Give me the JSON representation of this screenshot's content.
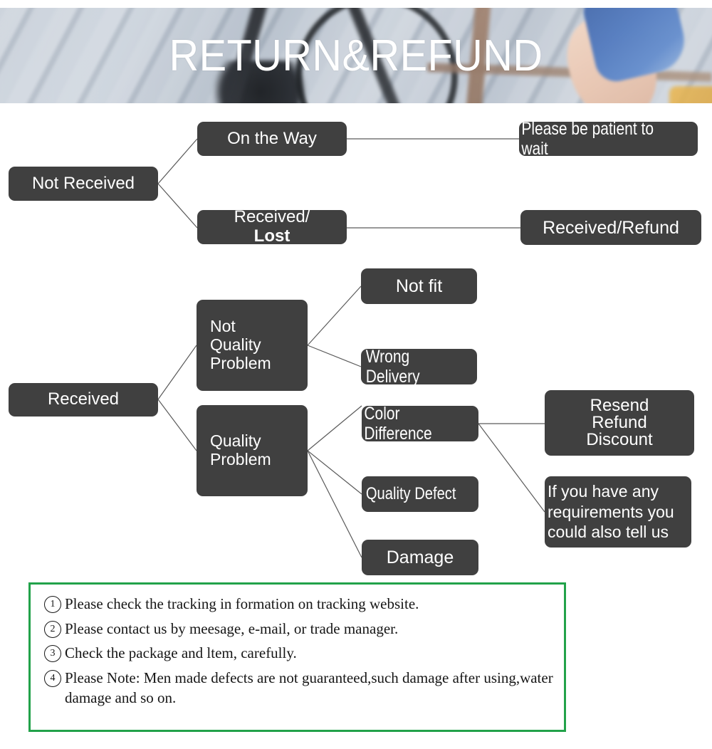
{
  "banner": {
    "title": "RETURN&REFUND"
  },
  "flowchart": {
    "nodes": {
      "not_received": "Not Received",
      "on_the_way": "On the Way",
      "received_lost_prefix": "Received/",
      "received_lost_bold": "Lost",
      "please_be_patient": "Please be patient to wait",
      "received_refund": "Received/Refund",
      "received": "Received",
      "not_quality_problem": "Not\nQuality\nProblem",
      "quality_problem": "Quality\nProblem",
      "not_fit": "Not fit",
      "wrong_delivery": "Wrong Delivery",
      "color_difference": "Color Difference",
      "quality_defect": "Quality Defect",
      "damage": "Damage",
      "resend_refund_discount": "Resend\nRefund\nDiscount",
      "if_you_have_any": "If you have any\nrequirements you\ncould also tell us"
    },
    "colors": {
      "node_fill": "#404040",
      "node_text": "#ffffff",
      "connector": "#5a5a5a"
    }
  },
  "notes": {
    "border_color": "#22a24a",
    "items": [
      {
        "num": "1",
        "text": "Please check the tracking in formation on tracking website."
      },
      {
        "num": "2",
        "text": "Please contact us by meesage, e-mail, or trade manager."
      },
      {
        "num": "3",
        "text": "Check the package and ltem, carefully."
      },
      {
        "num": "4",
        "text": "Please Note: Men made defects  are not guaranteed,such damage after using,water damage and so on."
      }
    ]
  }
}
